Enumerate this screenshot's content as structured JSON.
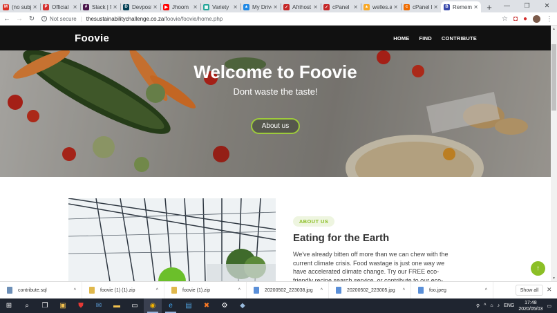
{
  "browser": {
    "tabs": [
      {
        "title": "(no subj",
        "icon": "gmail-icon",
        "color": "#d93025",
        "glyph": "M"
      },
      {
        "title": "Official",
        "icon": "pdf-icon",
        "color": "#d32f2f",
        "glyph": "P"
      },
      {
        "title": "Slack | f",
        "icon": "slack-icon",
        "color": "#4a154b",
        "glyph": "#"
      },
      {
        "title": "Devpost",
        "icon": "devpost-icon",
        "color": "#003e54",
        "glyph": "D"
      },
      {
        "title": "Jhoom",
        "icon": "youtube-icon",
        "color": "#ff0000",
        "glyph": "▶"
      },
      {
        "title": "Variety",
        "icon": "sheets-icon",
        "color": "#26a69a",
        "glyph": "▦"
      },
      {
        "title": "My Drive",
        "icon": "drive-icon",
        "color": "#1e88e5",
        "glyph": "▲"
      },
      {
        "title": "Afrihost",
        "icon": "afrihost-icon",
        "color": "#c62828",
        "glyph": "✓"
      },
      {
        "title": "cPanel",
        "icon": "cpanel-icon",
        "color": "#c62828",
        "glyph": "✓"
      },
      {
        "title": "welles.a",
        "icon": "welles-icon",
        "color": "#f9a825",
        "glyph": "▲"
      },
      {
        "title": "cPanel F",
        "icon": "cpanel-orange-icon",
        "color": "#ef6c00",
        "glyph": "c"
      },
      {
        "title": "Rememe",
        "icon": "remember-icon",
        "color": "#3949ab",
        "glyph": "B",
        "active": true
      }
    ],
    "new_tab": "+",
    "window_controls": [
      "—",
      "❐",
      "✕"
    ],
    "security_label": "Not secure",
    "url_host": "thesustainabilitychallenge.co.za",
    "url_path": "/foovie/foovie/home.php"
  },
  "site": {
    "logo": "Foovie",
    "nav": [
      "HOME",
      "FIND",
      "CONTRIBUTE"
    ],
    "hero_title": "Welcome to Foovie",
    "hero_subtitle": "Dont waste the taste!",
    "hero_button": "About us",
    "about_badge": "ABOUT US",
    "about_title": "Eating for the Earth",
    "about_text": "We've already bitten off more than we can chew with the current climate crisis. Food wastage is just one way we have accelerated climate change. Try our FREE eco-friendly recipe search service, or contribute to our eco-friendly recipe",
    "accent_color": "#8cbf26",
    "scroll_top_icon": "arrow-up-icon"
  },
  "downloads": {
    "items": [
      {
        "name": "contribute.sql",
        "icon": "sql-file-icon",
        "color": "#6d8fb7"
      },
      {
        "name": "foovie (1) (1).zip",
        "icon": "zip-file-icon",
        "color": "#e0b84c"
      },
      {
        "name": "foovie (1).zip",
        "icon": "zip-file-icon",
        "color": "#e0b84c"
      },
      {
        "name": "20200502_223038.jpg",
        "icon": "image-file-icon",
        "color": "#5a8fd8"
      },
      {
        "name": "20200502_223005.jpg",
        "icon": "image-file-icon",
        "color": "#5a8fd8"
      },
      {
        "name": "foo.jpeg",
        "icon": "image-file-icon",
        "color": "#5a8fd8"
      }
    ],
    "show_all": "Show all"
  },
  "taskbar": {
    "language": "ENG",
    "time": "17:48",
    "date": "2020/05/03"
  }
}
